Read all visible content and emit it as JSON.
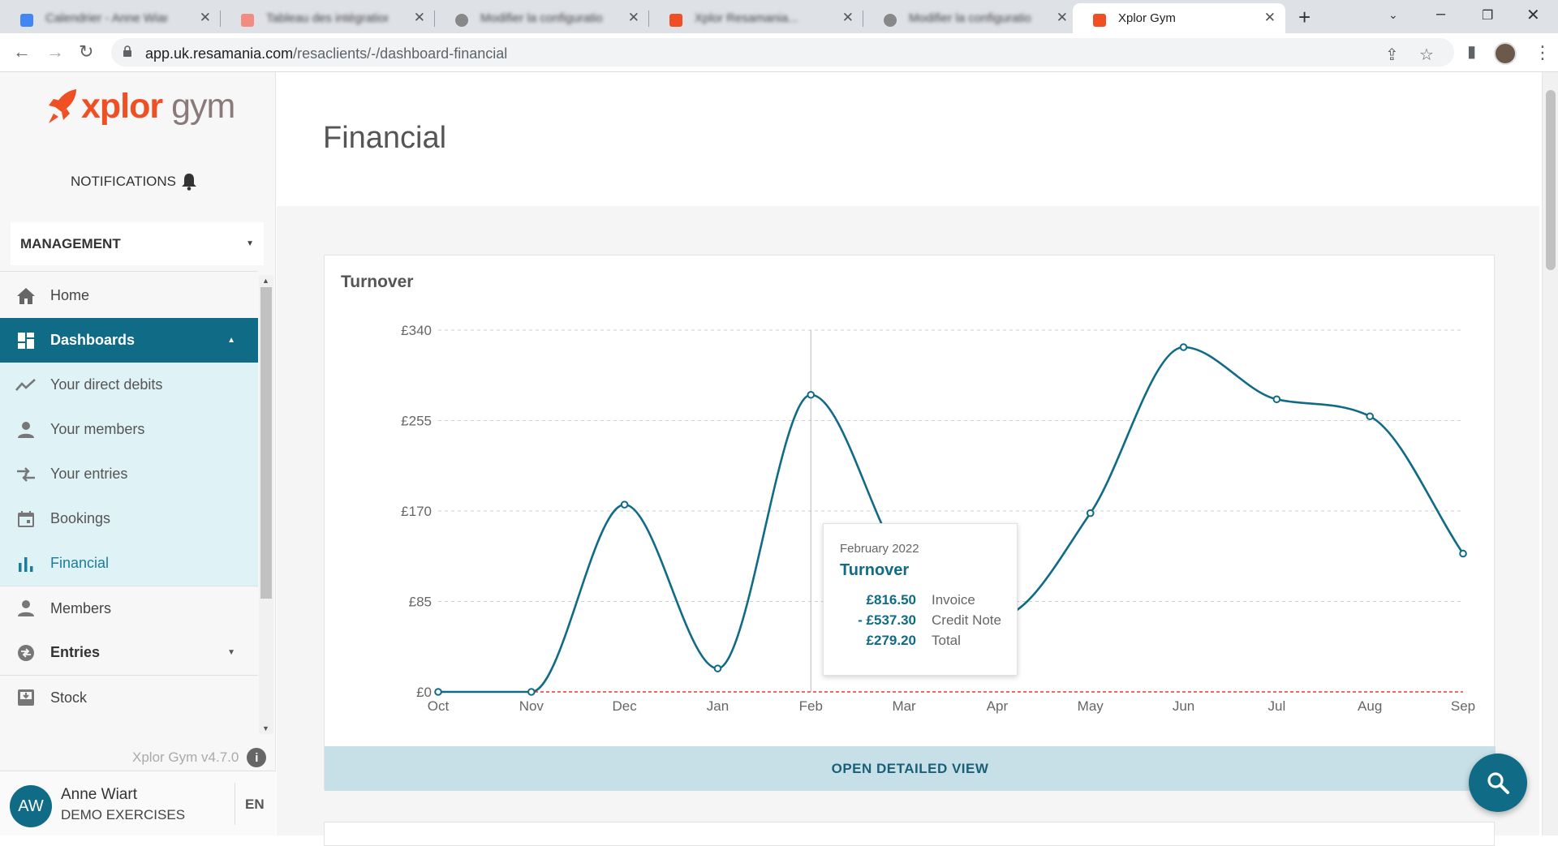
{
  "browser": {
    "tabs": [
      {
        "title": "Calendrier - Anne Wiart - G..."
      },
      {
        "title": "Tableau des intégrations..."
      },
      {
        "title": "Modifier la configuration..."
      },
      {
        "title": "Xplor Resamania..."
      },
      {
        "title": "Modifier la configuration..."
      },
      {
        "title": "Xplor Gym"
      }
    ],
    "url_host": "app.uk.resamania.com",
    "url_path": "/resaclients/-/dashboard-financial"
  },
  "sidebar": {
    "brand_main": "xplor",
    "brand_sub": " gym",
    "notifications_label": "NOTIFICATIONS",
    "management_label": "MANAGEMENT",
    "items": [
      {
        "label": "Home",
        "icon": "home-icon"
      },
      {
        "label": "Dashboards",
        "icon": "dashboard-icon"
      },
      {
        "label": "Your direct debits",
        "icon": "trend-icon"
      },
      {
        "label": "Your members",
        "icon": "person-icon"
      },
      {
        "label": "Your entries",
        "icon": "swap-icon"
      },
      {
        "label": "Bookings",
        "icon": "calendar-icon"
      },
      {
        "label": "Financial",
        "icon": "bar-chart-icon"
      },
      {
        "label": "Members",
        "icon": "person-icon"
      },
      {
        "label": "Entries",
        "icon": "entries-icon"
      },
      {
        "label": "Stock",
        "icon": "stock-icon"
      }
    ],
    "version": "Xplor Gym v4.7.0",
    "user": {
      "initials": "AW",
      "name": "Anne Wiart",
      "org": "DEMO EXERCISES",
      "lang": "EN"
    }
  },
  "main": {
    "page_title": "Financial",
    "card_title": "Turnover",
    "open_button": "OPEN DETAILED VIEW",
    "tooltip": {
      "date": "February 2022",
      "series": "Turnover",
      "rows": [
        {
          "value": "£816.50",
          "label": "Invoice"
        },
        {
          "value": "- £537.30",
          "label": "Credit Note"
        },
        {
          "value": "£279.20",
          "label": "Total"
        }
      ]
    }
  },
  "colors": {
    "accent": "#106b86",
    "brand": "#f04e23",
    "zero_line": "#e53935"
  },
  "chart_data": {
    "type": "line",
    "title": "Turnover",
    "categories": [
      "Oct",
      "Nov",
      "Dec",
      "Jan",
      "Feb",
      "Mar",
      "Apr",
      "May",
      "Jun",
      "Jul",
      "Aug",
      "Sep"
    ],
    "series": [
      {
        "values": [
          0,
          0,
          176,
          22,
          279.2,
          120,
          70,
          168,
          324,
          275,
          259,
          130
        ]
      }
    ],
    "y_ticks": [
      "£0",
      "£85",
      "£170",
      "£255",
      "£340"
    ],
    "ylim": [
      0,
      340
    ],
    "grid": true,
    "highlight_category": "Feb"
  }
}
